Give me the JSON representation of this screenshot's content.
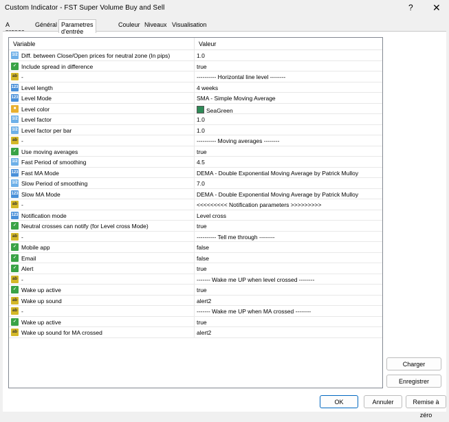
{
  "window": {
    "title": "Custom Indicator - FST Super Volume Buy and Sell",
    "help_label": "?",
    "close_label": "✕"
  },
  "tabs": [
    {
      "label": "A propos"
    },
    {
      "label": "Général"
    },
    {
      "label": "Parametres d'entrée"
    },
    {
      "label": "Couleur"
    },
    {
      "label": "Niveaux"
    },
    {
      "label": "Visualisation"
    }
  ],
  "grid": {
    "col_variable": "Variable",
    "col_value": "Valeur",
    "rows": [
      {
        "icon": "float",
        "name": "Diff. between Close/Open prices for neutral zone (In pips)",
        "value": "1.0"
      },
      {
        "icon": "bool",
        "name": "Include spread in difference",
        "value": "true"
      },
      {
        "icon": "str",
        "name": "-",
        "value": "---------- Horizontal line level --------"
      },
      {
        "icon": "num",
        "name": "Level length",
        "value": "4 weeks"
      },
      {
        "icon": "num",
        "name": "Level Mode",
        "value": "SMA - Simple Moving Average"
      },
      {
        "icon": "color",
        "name": "Level color",
        "value": "SeaGreen"
      },
      {
        "icon": "float",
        "name": "Level factor",
        "value": "1.0"
      },
      {
        "icon": "float",
        "name": "Level factor per bar",
        "value": "1.0"
      },
      {
        "icon": "str",
        "name": "-",
        "value": "---------- Moving averages --------"
      },
      {
        "icon": "bool",
        "name": "Use moving averages",
        "value": "true"
      },
      {
        "icon": "float",
        "name": "Fast Period of smoothing",
        "value": "4.5"
      },
      {
        "icon": "num",
        "name": "Fast MA Mode",
        "value": "DEMA - Double Exponential Moving Average by Patrick Mulloy"
      },
      {
        "icon": "float",
        "name": "Slow Period of smoothing",
        "value": "7.0"
      },
      {
        "icon": "num",
        "name": "Slow MA Mode",
        "value": "DEMA - Double Exponential Moving Average by Patrick Mulloy"
      },
      {
        "icon": "str",
        "name": "-",
        "value": "<<<<<<<<< Notification parameters >>>>>>>>>"
      },
      {
        "icon": "num",
        "name": "Notification mode",
        "value": "Level cross"
      },
      {
        "icon": "bool",
        "name": "Neutral crosses can notify (for Level cross Mode)",
        "value": "true"
      },
      {
        "icon": "str",
        "name": "-",
        "value": "---------- Tell me through --------"
      },
      {
        "icon": "bool",
        "name": "Mobile app",
        "value": "false"
      },
      {
        "icon": "bool",
        "name": "Email",
        "value": "false"
      },
      {
        "icon": "bool",
        "name": "Alert",
        "value": "true"
      },
      {
        "icon": "str",
        "name": "-",
        "value": "------- Wake me UP when level crossed  --------"
      },
      {
        "icon": "bool",
        "name": "Wake up active",
        "value": "true"
      },
      {
        "icon": "str",
        "name": "Wake up sound",
        "value": "alert2"
      },
      {
        "icon": "str",
        "name": "-",
        "value": "------- Wake me UP when MA crossed  --------"
      },
      {
        "icon": "bool",
        "name": "Wake up active",
        "value": "true"
      },
      {
        "icon": "str",
        "name": "Wake up sound for MA crossed",
        "value": "alert2"
      }
    ]
  },
  "side_buttons": {
    "load": "Charger",
    "save": "Enregistrer"
  },
  "footer_buttons": {
    "ok": "OK",
    "cancel": "Annuler",
    "reset": "Remise à zéro"
  },
  "colors": {
    "accent": "#0067c0",
    "seagreen": "#2e8b57"
  }
}
